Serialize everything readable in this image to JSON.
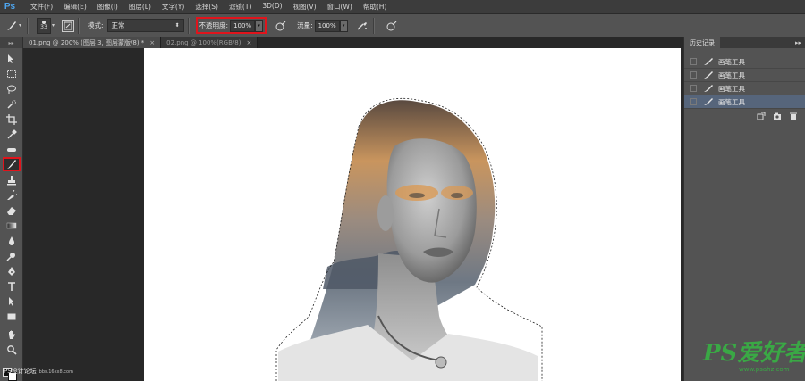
{
  "app": {
    "logo": "Ps"
  },
  "menu": [
    "文件(F)",
    "编辑(E)",
    "图像(I)",
    "图层(L)",
    "文字(Y)",
    "选择(S)",
    "滤镜(T)",
    "3D(D)",
    "视图(V)",
    "窗口(W)",
    "帮助(H)"
  ],
  "options": {
    "brush_size": "33",
    "mode_label": "模式:",
    "mode_value": "正常",
    "opacity_label": "不透明度:",
    "opacity_value": "100%",
    "flow_label": "流量:",
    "flow_value": "100%"
  },
  "tabs": [
    {
      "label": "01.png @ 200% (图层 3, 图层蒙版/8) *",
      "close": "×"
    },
    {
      "label": "02.png @ 100%(RGB/8)",
      "close": "×"
    }
  ],
  "panel": {
    "tab": "历史记录",
    "collapse": "▸▸",
    "menu": "≡",
    "history": [
      "画笔工具",
      "画笔工具",
      "画笔工具",
      "画笔工具"
    ]
  },
  "watermarks": {
    "left": "PS设计论坛",
    "left_small": "bbs.16xx8.com",
    "right_main": "PS爱好者",
    "right_sub": "www.psahz.com"
  },
  "colors": {
    "accent_highlight": "#e0141c",
    "ps_logo": "#4ea6f0",
    "watermark_green": "#3aa845",
    "history_selected": "#56657b"
  }
}
